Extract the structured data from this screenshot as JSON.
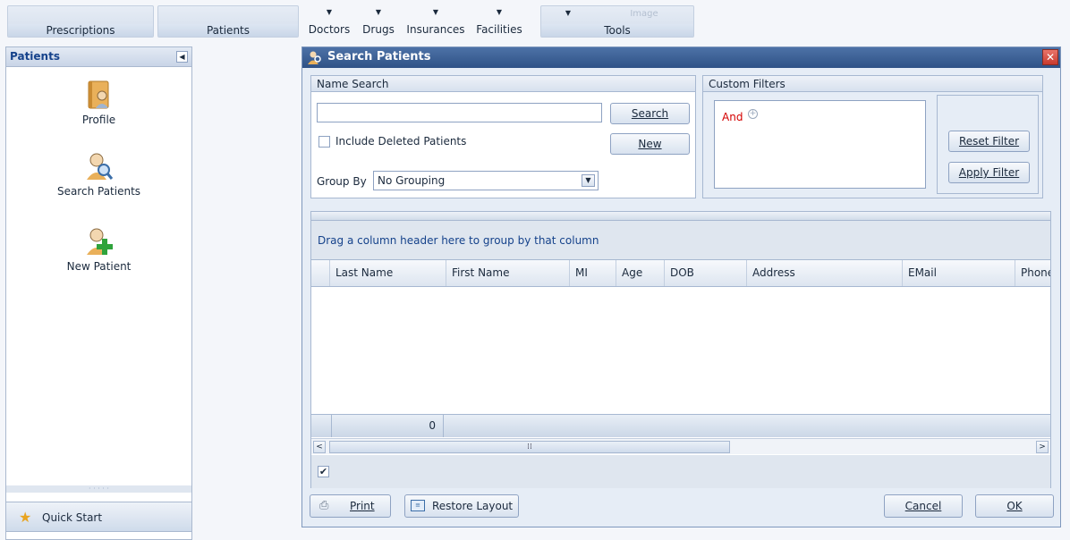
{
  "ribbon": {
    "groups": [
      {
        "label": "Prescriptions"
      },
      {
        "label": "Patients"
      },
      {
        "label": "",
        "items": [
          {
            "arrow": "▼",
            "label": "Doctors"
          },
          {
            "arrow": "▼",
            "label": "Drugs"
          },
          {
            "arrow": "▼",
            "label": "Insurances"
          },
          {
            "arrow": "▼",
            "label": "Facilities"
          }
        ]
      },
      {
        "label": "Tools",
        "items": [
          {
            "arrow": "▼",
            "label": ""
          },
          {
            "arrow": "",
            "label": "",
            "ghost": "Image"
          }
        ]
      }
    ]
  },
  "sidebar": {
    "title": "Patients",
    "items": [
      {
        "label": "Profile",
        "icon": "profile-book-icon"
      },
      {
        "label": "Search Patients",
        "icon": "search-patient-icon"
      },
      {
        "label": "New Patient",
        "icon": "new-patient-icon"
      }
    ],
    "grip": "· · · · ·",
    "quick_start": "Quick Start"
  },
  "dialog": {
    "title": "Search Patients",
    "close": "✕",
    "name_search": {
      "header": "Name Search",
      "search_value": "",
      "search_button": "Search",
      "include_deleted_label": "Include Deleted Patients",
      "include_deleted_checked": false,
      "new_button": "New",
      "group_by_label": "Group By",
      "group_by_value": "No Grouping"
    },
    "custom_filters": {
      "header": "Custom Filters",
      "root_operator": "And",
      "reset_button": "Reset Filter",
      "apply_button": "Apply Filter"
    },
    "grid": {
      "group_hint": "Drag a column header here to group by that column",
      "columns": [
        "Last Name",
        "First Name",
        "MI",
        "Age",
        "DOB",
        "Address",
        "EMail",
        "Phone"
      ],
      "rows": [],
      "footer_count": "0",
      "auto_filter_checked": true
    },
    "footer": {
      "print_button": "Print",
      "restore_layout_button": "Restore Layout",
      "cancel_button": "Cancel",
      "ok_button": "OK"
    }
  },
  "colors": {
    "title_bar": "#3b5f94",
    "accent_text": "#15428b",
    "filter_operator": "#d40000",
    "close_button": "#d9534a"
  }
}
